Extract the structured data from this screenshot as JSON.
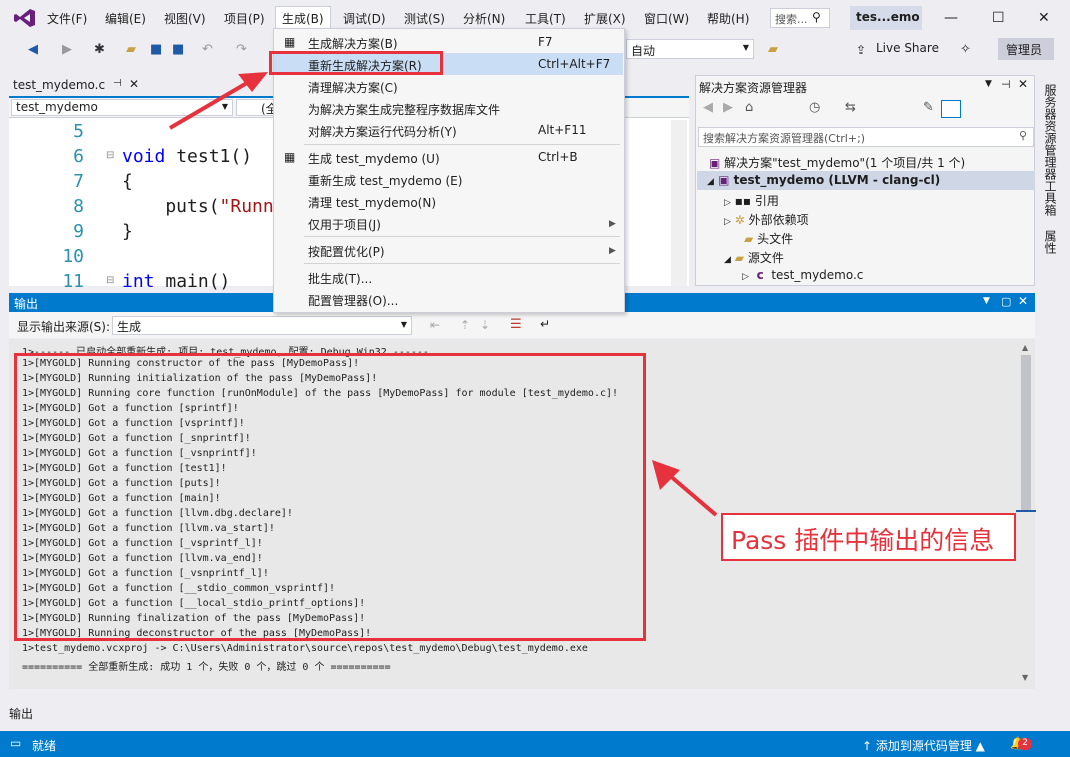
{
  "menubar": {
    "items": [
      "文件(F)",
      "编辑(E)",
      "视图(V)",
      "项目(P)",
      "生成(B)",
      "调试(D)",
      "测试(S)",
      "分析(N)",
      "工具(T)",
      "扩展(X)",
      "窗口(W)",
      "帮助(H)"
    ],
    "quick_search": "搜索...",
    "project_title": "tes...emo"
  },
  "toolbar": {
    "platform": "自动",
    "live_share": "Live Share",
    "admin": "管理员"
  },
  "editor": {
    "tab": "test_mydemo.c",
    "nav_combo": "test_mydemo",
    "nav_combo2": "(全",
    "lines": [
      {
        "no": "5",
        "code": ""
      },
      {
        "no": "6",
        "kw": "void",
        "code": " test1()"
      },
      {
        "no": "7",
        "code": "{"
      },
      {
        "no": "8",
        "code": "    puts(",
        "str": "\"Runn"
      },
      {
        "no": "9",
        "code": "}"
      },
      {
        "no": "10",
        "code": ""
      },
      {
        "no": "11",
        "kw": "int",
        "code": " main()"
      }
    ]
  },
  "build_menu": {
    "items": [
      {
        "label": "生成解决方案(B)",
        "shortcut": "F7"
      },
      {
        "label": "重新生成解决方案(R)",
        "shortcut": "Ctrl+Alt+F7"
      },
      {
        "label": "清理解决方案(C)",
        "shortcut": ""
      },
      {
        "label": "为解决方案生成完整程序数据库文件",
        "shortcut": ""
      },
      {
        "label": "对解决方案运行代码分析(Y)",
        "shortcut": "Alt+F11"
      },
      {
        "label": "生成 test_mydemo (U)",
        "shortcut": "Ctrl+B"
      },
      {
        "label": "重新生成 test_mydemo (E)",
        "shortcut": ""
      },
      {
        "label": "清理 test_mydemo(N)",
        "shortcut": ""
      },
      {
        "label": "仅用于项目(J)",
        "shortcut": ""
      },
      {
        "label": "按配置优化(P)",
        "shortcut": ""
      },
      {
        "label": "批生成(T)...",
        "shortcut": ""
      },
      {
        "label": "配置管理器(O)...",
        "shortcut": ""
      }
    ]
  },
  "solution_explorer": {
    "title": "解决方案资源管理器",
    "search_placeholder": "搜索解决方案资源管理器(Ctrl+;)",
    "tree": [
      "解决方案\"test_mydemo\"(1 个项目/共 1 个)",
      "test_mydemo (LLVM - clang-cl)",
      "引用",
      "外部依赖项",
      "头文件",
      "源文件",
      "test_mydemo.c"
    ]
  },
  "side_tabs": [
    "服务器资源管理器",
    "工具箱",
    "属性"
  ],
  "output": {
    "title": "输出",
    "source_label": "显示输出来源(S):",
    "source_value": "生成",
    "lines": [
      "1>------ 已启动全部重新生成: 项目: test_mydemo, 配置: Debug Win32 ------",
      "1>[MYGOLD] Running constructor of the pass [MyDemoPass]!",
      "1>[MYGOLD] Running initialization of the pass [MyDemoPass]!",
      "1>[MYGOLD] Running core function [runOnModule] of the pass [MyDemoPass] for module [test_mydemo.c]!",
      "1>[MYGOLD] Got a function [sprintf]!",
      "1>[MYGOLD] Got a function [vsprintf]!",
      "1>[MYGOLD] Got a function [_snprintf]!",
      "1>[MYGOLD] Got a function [_vsnprintf]!",
      "1>[MYGOLD] Got a function [test1]!",
      "1>[MYGOLD] Got a function [puts]!",
      "1>[MYGOLD] Got a function [main]!",
      "1>[MYGOLD] Got a function [llvm.dbg.declare]!",
      "1>[MYGOLD] Got a function [llvm.va_start]!",
      "1>[MYGOLD] Got a function [_vsprintf_l]!",
      "1>[MYGOLD] Got a function [llvm.va_end]!",
      "1>[MYGOLD] Got a function [_vsnprintf_l]!",
      "1>[MYGOLD] Got a function [__stdio_common_vsprintf]!",
      "1>[MYGOLD] Got a function [__local_stdio_printf_options]!",
      "1>[MYGOLD] Running finalization of the pass [MyDemoPass]!",
      "1>[MYGOLD] Running deconstructor of the pass [MyDemoPass]!",
      "1>test_mydemo.vcxproj -> C:\\Users\\Administrator\\source\\repos\\test_mydemo\\Debug\\test_mydemo.exe",
      "========== 全部重新生成: 成功 1 个，失败 0 个，跳过 0 个 =========="
    ],
    "bottom_tab": "输出"
  },
  "annotation": {
    "callout": "Pass 插件中输出的信息",
    "color": "#e6323c"
  },
  "statusbar": {
    "text": "就绪",
    "right": "↑ 添加到源代码管理 ▲",
    "notifications": "2"
  }
}
